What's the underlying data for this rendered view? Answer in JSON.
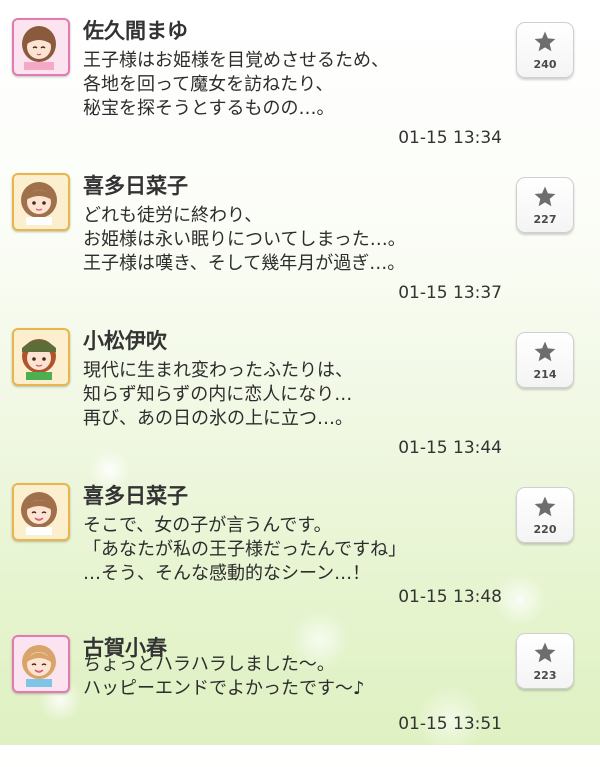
{
  "posts": [
    {
      "name": "佐久間まゆ",
      "lines": [
        "王子様はお姫様を目覚めさせるため、",
        "各地を回って魔女を訪ねたり、",
        "秘宝を探そうとするものの…。"
      ],
      "time": "01-15 13:34",
      "star_count": "240",
      "avatar_icon": "character-avatar-icon",
      "frame_color": "#e27bb0"
    },
    {
      "name": "喜多日菜子",
      "lines": [
        "どれも徒労に終わり、",
        "お姫様は永い眠りについてしまった…。",
        "王子様は嘆き、そして幾年月が過ぎ…。"
      ],
      "time": "01-15 13:37",
      "star_count": "227",
      "avatar_icon": "character-avatar-icon",
      "frame_color": "#e8b64a"
    },
    {
      "name": "小松伊吹",
      "lines": [
        "現代に生まれ変わったふたりは、",
        "知らず知らずの内に恋人になり…",
        "再び、あの日の氷の上に立つ…。"
      ],
      "time": "01-15 13:44",
      "star_count": "214",
      "avatar_icon": "character-avatar-icon",
      "frame_color": "#e8b64a"
    },
    {
      "name": "喜多日菜子",
      "lines": [
        "そこで、女の子が言うんです。",
        "「あなたが私の王子様だったんですね」",
        "…そう、そんな感動的なシーン…！"
      ],
      "time": "01-15 13:48",
      "star_count": "220",
      "avatar_icon": "character-avatar-icon",
      "frame_color": "#e8b64a"
    },
    {
      "name": "古賀小春",
      "lines": [
        "ちょっとハラハラしました〜。",
        "ハッピーエンドでよかったです〜♪"
      ],
      "time": "01-15 13:51",
      "star_count": "223",
      "avatar_icon": "character-avatar-icon",
      "frame_color": "#e27bb0"
    }
  ],
  "star_icon": "star-icon"
}
